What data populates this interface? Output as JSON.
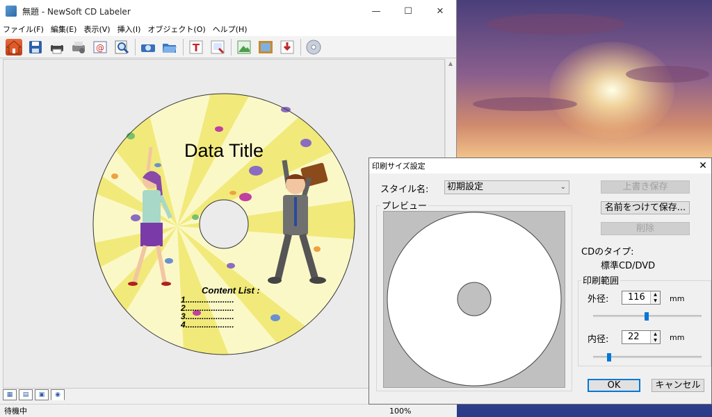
{
  "main_window": {
    "title": "無題 - NewSoft CD Labeler",
    "controls": {
      "minimize": "—",
      "maximize": "☐",
      "close": "✕"
    },
    "menu": [
      "ファイル(F)",
      "編集(E)",
      "表示(V)",
      "挿入(I)",
      "オブジェクト(O)",
      "ヘルプ(H)"
    ],
    "toolbar_icons": [
      "home-icon",
      "save-icon",
      "print-icon",
      "print-setup-icon",
      "email-icon",
      "zoom-icon",
      "scan-icon",
      "open-folder-icon",
      "text-icon",
      "insert-image-icon",
      "add-image-icon",
      "frame-icon",
      "import-icon",
      "cd-icon"
    ],
    "label": {
      "title": "Data Title",
      "content_heading": "Content List :",
      "content_lines": [
        "1.....................",
        "2.....................",
        "3.....................",
        "4....................."
      ],
      "colors": {
        "disc_bg": "#fbf8c8",
        "rays": "#f1ea7a",
        "dot_purple": "#8a6cc0",
        "dot_green": "#7ac06b",
        "dot_orange": "#f0a040",
        "dot_magenta": "#c040a0"
      }
    },
    "view_tabs": [
      "grid-view-icon",
      "list-view-icon",
      "page-view-icon",
      "disc-view-icon"
    ],
    "status": {
      "text": "待機中",
      "zoom": "100%"
    }
  },
  "dialog": {
    "title": "印刷サイズ設定",
    "close": "✕",
    "style_name_label": "スタイル名:",
    "style_name_value": "初期設定",
    "preview_label": "プレビュー",
    "buttons": {
      "overwrite_save": "上書き保存",
      "save_as": "名前をつけて保存...",
      "delete": "削除",
      "ok": "OK",
      "cancel": "キャンセル"
    },
    "cd_type_label": "CDのタイプ:",
    "cd_type_value": "標準CD/DVD",
    "print_range_label": "印刷範囲",
    "outer": {
      "label": "外径:",
      "value": "116",
      "unit": "mm"
    },
    "inner": {
      "label": "内径:",
      "value": "22",
      "unit": "mm"
    }
  }
}
